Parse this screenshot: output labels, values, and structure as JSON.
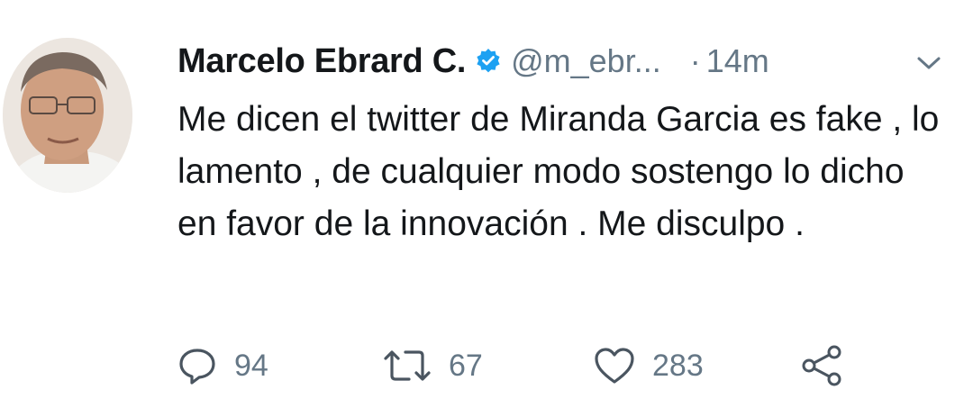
{
  "tweet": {
    "author_name": "Marcelo Ebrard C.",
    "handle": "@m_ebr...",
    "separator": "·",
    "time": "14m",
    "text": "Me dicen el twitter de Miranda Garcia es fake , lo lamento , de cualquier modo sostengo lo dicho en favor de la innovación . Me disculpo ."
  },
  "actions": {
    "reply_count": "94",
    "retweet_count": "67",
    "like_count": "283"
  },
  "icons": {
    "verified": "verified-badge-icon",
    "more": "chevron-down-icon",
    "reply": "reply-icon",
    "retweet": "retweet-icon",
    "like": "heart-icon",
    "share": "share-icon"
  },
  "colors": {
    "verified_blue": "#1da1f2",
    "text": "#14171a",
    "muted": "#657786"
  }
}
